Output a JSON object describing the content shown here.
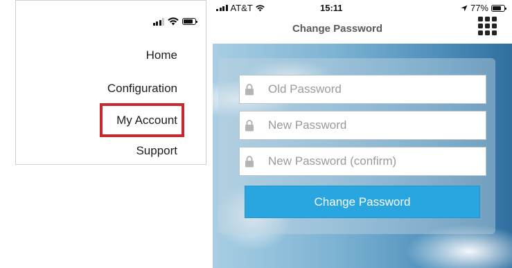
{
  "menu": {
    "items": [
      {
        "label": "Home"
      },
      {
        "label": "Configuration"
      },
      {
        "label": "My Account",
        "highlighted": true
      },
      {
        "label": "Support"
      }
    ],
    "highlight_color": "#c8282d"
  },
  "phone": {
    "statusbar": {
      "carrier": "AT&T",
      "time": "15:11",
      "battery": "77%"
    },
    "title": "Change Password",
    "fields": [
      {
        "placeholder": "Old Password",
        "value": ""
      },
      {
        "placeholder": "New Password",
        "value": ""
      },
      {
        "placeholder": "New Password (confirm)",
        "value": ""
      }
    ],
    "submit_label": "Change Password",
    "accent_color": "#29a5df"
  }
}
